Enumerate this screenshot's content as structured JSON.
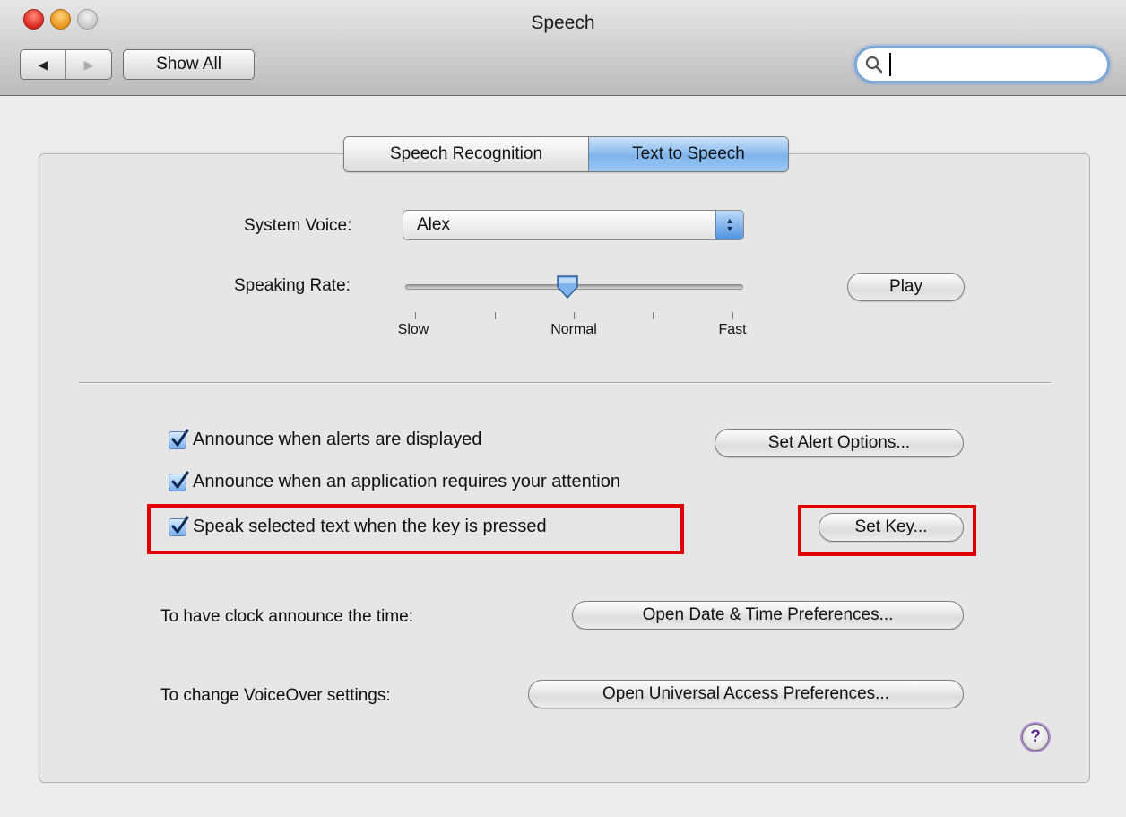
{
  "window": {
    "title": "Speech"
  },
  "toolbar": {
    "back_icon": "◀",
    "forward_icon": "▶",
    "show_all_label": "Show All",
    "search_value": "",
    "search_placeholder": ""
  },
  "tabs": [
    {
      "label": "Speech Recognition",
      "selected": false
    },
    {
      "label": "Text to Speech",
      "selected": true
    }
  ],
  "voice": {
    "label": "System Voice:",
    "selected": "Alex"
  },
  "rate": {
    "label": "Speaking Rate:",
    "value": 0.48,
    "tick_labels": [
      "Slow",
      "Normal",
      "Fast"
    ],
    "play_label": "Play"
  },
  "options": {
    "alerts": {
      "label": "Announce when alerts are displayed",
      "checked": true,
      "button": "Set Alert Options..."
    },
    "attention": {
      "label": "Announce when an application requires your attention",
      "checked": true
    },
    "speak_selected": {
      "label": "Speak selected text when the key is pressed",
      "checked": true,
      "button": "Set Key..."
    }
  },
  "clock": {
    "label": "To have clock announce the time:",
    "button": "Open Date & Time Preferences..."
  },
  "voiceover": {
    "label": "To change VoiceOver settings:",
    "button": "Open Universal Access Preferences..."
  },
  "help": {
    "label": "?"
  },
  "colors": {
    "highlight": "#e00000",
    "active_tab": "#7fb5ec"
  }
}
